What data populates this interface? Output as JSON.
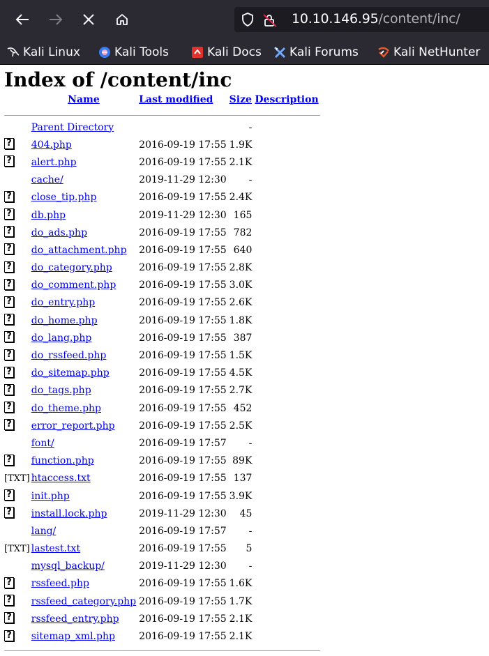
{
  "browser": {
    "url_host": "10.10.146.95",
    "url_path": "/content/inc/",
    "bookmarks": [
      {
        "label": "Kali Linux",
        "icon": "kali-dragon-icon"
      },
      {
        "label": "Kali Tools",
        "icon": "kali-tools-icon"
      },
      {
        "label": "Kali Docs",
        "icon": "kali-docs-icon"
      },
      {
        "label": "Kali Forums",
        "icon": "kali-forums-icon"
      },
      {
        "label": "Kali NetHunter",
        "icon": "kali-nethunter-icon"
      }
    ]
  },
  "page": {
    "heading": "Index of /content/inc",
    "columns": {
      "name": "Name",
      "last_modified": "Last modified",
      "size": "Size",
      "description": "Description"
    },
    "rows": [
      {
        "icon": "none",
        "name": "Parent Directory",
        "modified": "",
        "size": "-"
      },
      {
        "icon": "unknown",
        "name": "404.php",
        "modified": "2016-09-19 17:55",
        "size": "1.9K"
      },
      {
        "icon": "unknown",
        "name": "alert.php",
        "modified": "2016-09-19 17:55",
        "size": "2.1K"
      },
      {
        "icon": "none",
        "name": "cache/",
        "modified": "2019-11-29 12:30",
        "size": "-"
      },
      {
        "icon": "unknown",
        "name": "close_tip.php",
        "modified": "2016-09-19 17:55",
        "size": "2.4K"
      },
      {
        "icon": "unknown",
        "name": "db.php",
        "modified": "2019-11-29 12:30",
        "size": "165"
      },
      {
        "icon": "unknown",
        "name": "do_ads.php",
        "modified": "2016-09-19 17:55",
        "size": "782"
      },
      {
        "icon": "unknown",
        "name": "do_attachment.php",
        "modified": "2016-09-19 17:55",
        "size": "640"
      },
      {
        "icon": "unknown",
        "name": "do_category.php",
        "modified": "2016-09-19 17:55",
        "size": "2.8K"
      },
      {
        "icon": "unknown",
        "name": "do_comment.php",
        "modified": "2016-09-19 17:55",
        "size": "3.0K"
      },
      {
        "icon": "unknown",
        "name": "do_entry.php",
        "modified": "2016-09-19 17:55",
        "size": "2.6K"
      },
      {
        "icon": "unknown",
        "name": "do_home.php",
        "modified": "2016-09-19 17:55",
        "size": "1.8K"
      },
      {
        "icon": "unknown",
        "name": "do_lang.php",
        "modified": "2016-09-19 17:55",
        "size": "387"
      },
      {
        "icon": "unknown",
        "name": "do_rssfeed.php",
        "modified": "2016-09-19 17:55",
        "size": "1.5K"
      },
      {
        "icon": "unknown",
        "name": "do_sitemap.php",
        "modified": "2016-09-19 17:55",
        "size": "4.5K"
      },
      {
        "icon": "unknown",
        "name": "do_tags.php",
        "modified": "2016-09-19 17:55",
        "size": "2.7K"
      },
      {
        "icon": "unknown",
        "name": "do_theme.php",
        "modified": "2016-09-19 17:55",
        "size": "452"
      },
      {
        "icon": "unknown",
        "name": "error_report.php",
        "modified": "2016-09-19 17:55",
        "size": "2.5K"
      },
      {
        "icon": "none",
        "name": "font/",
        "modified": "2016-09-19 17:57",
        "size": "-"
      },
      {
        "icon": "unknown",
        "name": "function.php",
        "modified": "2016-09-19 17:55",
        "size": "89K"
      },
      {
        "icon": "txt",
        "name": "htaccess.txt",
        "modified": "2016-09-19 17:55",
        "size": "137"
      },
      {
        "icon": "unknown",
        "name": "init.php",
        "modified": "2016-09-19 17:55",
        "size": "3.9K"
      },
      {
        "icon": "unknown",
        "name": "install.lock.php",
        "modified": "2019-11-29 12:30",
        "size": "45"
      },
      {
        "icon": "none",
        "name": "lang/",
        "modified": "2016-09-19 17:57",
        "size": "-"
      },
      {
        "icon": "txt",
        "name": "lastest.txt",
        "modified": "2016-09-19 17:55",
        "size": "5"
      },
      {
        "icon": "none",
        "name": "mysql_backup/",
        "modified": "2019-11-29 12:30",
        "size": "-"
      },
      {
        "icon": "unknown",
        "name": "rssfeed.php",
        "modified": "2016-09-19 17:55",
        "size": "1.6K"
      },
      {
        "icon": "unknown",
        "name": "rssfeed_category.php",
        "modified": "2016-09-19 17:55",
        "size": "1.7K"
      },
      {
        "icon": "unknown",
        "name": "rssfeed_entry.php",
        "modified": "2016-09-19 17:55",
        "size": "2.1K"
      },
      {
        "icon": "unknown",
        "name": "sitemap_xml.php",
        "modified": "2016-09-19 17:55",
        "size": "2.1K"
      }
    ],
    "icon_labels": {
      "unknown": "?",
      "txt": "[TXT]"
    }
  }
}
